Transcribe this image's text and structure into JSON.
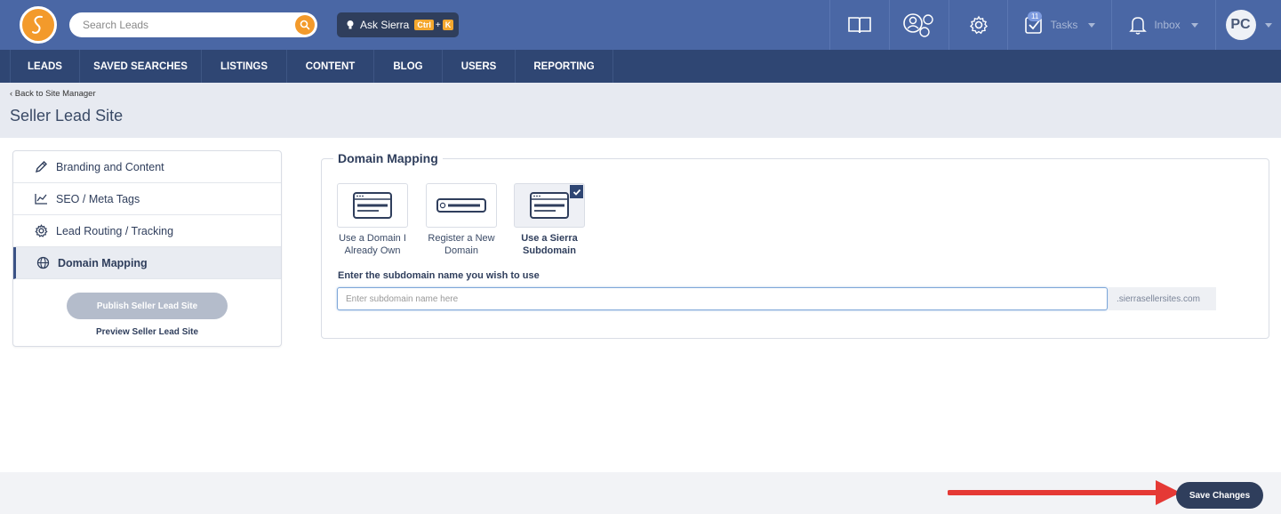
{
  "header": {
    "search_placeholder": "Search Leads",
    "ask": {
      "label": "Ask Sierra",
      "key1": "Ctrl",
      "plus": "+",
      "key2": "K"
    },
    "tasks": {
      "label": "Tasks",
      "count": "11"
    },
    "inbox": {
      "label": "Inbox"
    },
    "avatar_initials": "PC"
  },
  "nav": {
    "items": [
      {
        "label": "LEADS"
      },
      {
        "label": "SAVED SEARCHES"
      },
      {
        "label": "LISTINGS"
      },
      {
        "label": "CONTENT"
      },
      {
        "label": "BLOG"
      },
      {
        "label": "USERS"
      },
      {
        "label": "REPORTING"
      }
    ]
  },
  "page": {
    "back_link": "‹ Back to Site Manager",
    "title": "Seller Lead Site"
  },
  "sidebar": {
    "items": [
      {
        "label": "Branding and Content",
        "icon": "pencil-icon"
      },
      {
        "label": "SEO / Meta Tags",
        "icon": "chart-line-icon"
      },
      {
        "label": "Lead Routing / Tracking",
        "icon": "gear-icon"
      },
      {
        "label": "Domain Mapping",
        "icon": "globe-icon",
        "active": true
      }
    ],
    "publish_label": "Publish Seller Lead Site",
    "preview_label": "Preview Seller Lead Site"
  },
  "domain_mapping": {
    "title": "Domain Mapping",
    "options": [
      {
        "label": "Use a Domain I Already Own",
        "selected": false
      },
      {
        "label": "Register a New Domain",
        "selected": false
      },
      {
        "label": "Use a Sierra Subdomain",
        "selected": true
      }
    ],
    "subdomain_label": "Enter the subdomain name you wish to use",
    "subdomain_value": "",
    "subdomain_placeholder": "Enter subdomain name here",
    "suffix": ".sierrasellersites.com"
  },
  "footer": {
    "save_label": "Save Changes"
  },
  "colors": {
    "topbar": "#4a67a5",
    "nav": "#2f4673",
    "accent": "#f39a2b",
    "annotation_arrow": "#e53935"
  }
}
